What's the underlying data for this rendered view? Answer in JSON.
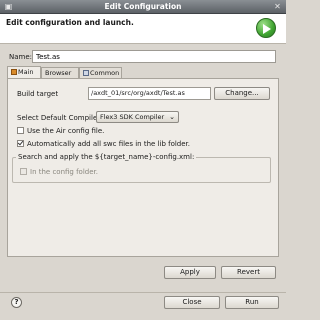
{
  "window": {
    "title": "Edit Configuration"
  },
  "header": {
    "title": "Edit configuration and launch."
  },
  "name": {
    "label": "Name:",
    "value": "Test.as"
  },
  "tabs": [
    {
      "label": "Main"
    },
    {
      "label": "Browser"
    },
    {
      "label": "Common"
    }
  ],
  "main": {
    "build_target_label": "Build target",
    "build_target_value": "/axdt_01/src/org/axdt/Test.as",
    "change_button": "Change...",
    "compiler_label": "Select Default Compiler",
    "compiler_value": "Flex3 SDK Compiler",
    "use_air_label": "Use the Air config file.",
    "use_air_checked": false,
    "auto_swc_label": "Automatically add all swc files in the lib folder.",
    "auto_swc_checked": true,
    "group_title": "Search and apply the ${target_name}-config.xml:",
    "config_folder_label": "In the config folder.",
    "config_folder_checked": false
  },
  "buttons": {
    "apply": "Apply",
    "revert": "Revert",
    "close": "Close",
    "run": "Run",
    "help": "?"
  },
  "colors": {
    "accent_run": "#3fa330",
    "panel_bg": "#efece7",
    "window_bg": "#dad6cf"
  }
}
